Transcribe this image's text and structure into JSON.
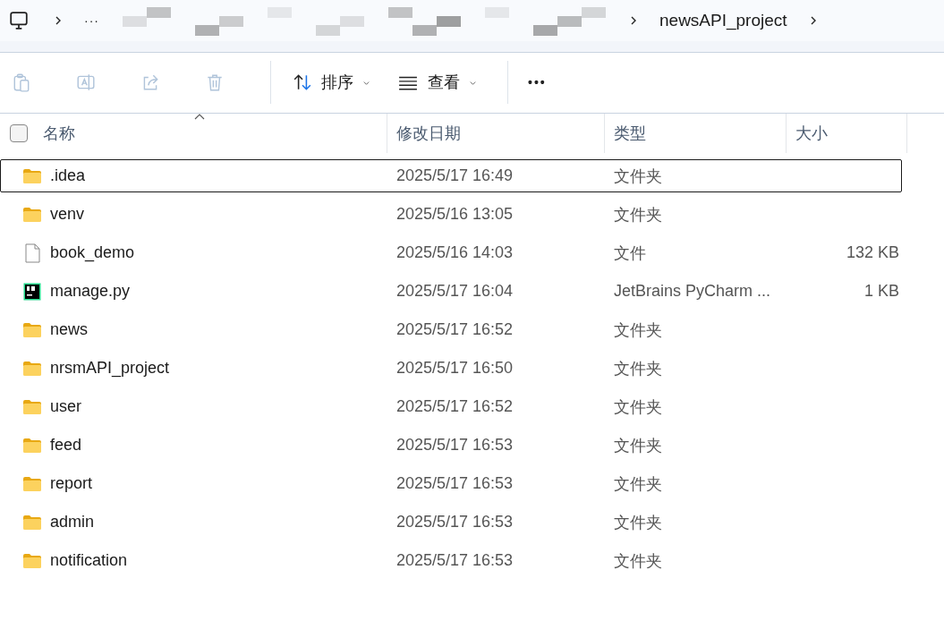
{
  "breadcrumb": {
    "overflow": "···",
    "current": "newsAPI_project"
  },
  "toolbar": {
    "icon_buttons": [
      {
        "kind": "paste",
        "disabled": true
      },
      {
        "kind": "rename",
        "disabled": true
      },
      {
        "kind": "share",
        "disabled": true
      },
      {
        "kind": "delete",
        "disabled": true
      }
    ],
    "menus": [
      {
        "kind": "sort",
        "label": "排序"
      },
      {
        "kind": "view",
        "label": "查看"
      }
    ],
    "more": "•••"
  },
  "select_all_checked": false,
  "columns": [
    "名称",
    "修改日期",
    "类型",
    "大小"
  ],
  "rows": [
    {
      "kind": "folder",
      "name": ".idea",
      "date": "2025/5/17 16:49",
      "type": "文件夹",
      "size": "",
      "focused": true
    },
    {
      "kind": "folder",
      "name": "venv",
      "date": "2025/5/16 13:05",
      "type": "文件夹",
      "size": "",
      "focused": false
    },
    {
      "kind": "file",
      "name": "book_demo",
      "date": "2025/5/16 14:03",
      "type": "文件",
      "size": "132 KB",
      "focused": false
    },
    {
      "kind": "pycharm",
      "name": "manage.py",
      "date": "2025/5/17 16:04",
      "type": "JetBrains PyCharm ...",
      "size": "1 KB",
      "focused": false
    },
    {
      "kind": "folder",
      "name": "news",
      "date": "2025/5/17 16:52",
      "type": "文件夹",
      "size": "",
      "focused": false
    },
    {
      "kind": "folder",
      "name": "nrsmAPI_project",
      "date": "2025/5/17 16:50",
      "type": "文件夹",
      "size": "",
      "focused": false
    },
    {
      "kind": "folder",
      "name": "user",
      "date": "2025/5/17 16:52",
      "type": "文件夹",
      "size": "",
      "focused": false
    },
    {
      "kind": "folder",
      "name": "feed",
      "date": "2025/5/17 16:53",
      "type": "文件夹",
      "size": "",
      "focused": false
    },
    {
      "kind": "folder",
      "name": "report",
      "date": "2025/5/17 16:53",
      "type": "文件夹",
      "size": "",
      "focused": false
    },
    {
      "kind": "folder",
      "name": "admin",
      "date": "2025/5/17 16:53",
      "type": "文件夹",
      "size": "",
      "focused": false
    },
    {
      "kind": "folder",
      "name": "notification",
      "date": "2025/5/17 16:53",
      "type": "文件夹",
      "size": "",
      "focused": false
    }
  ]
}
